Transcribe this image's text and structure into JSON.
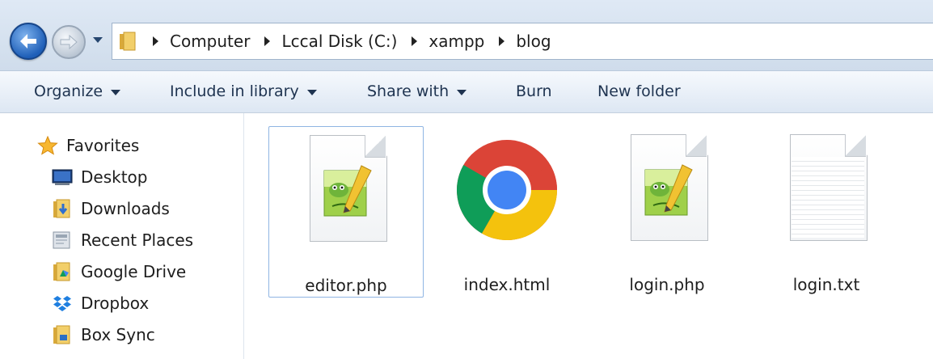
{
  "address": {
    "crumbs": [
      "Computer",
      "Lccal Disk (C:)",
      "xampp",
      "blog"
    ]
  },
  "toolbar": {
    "organize": "Organize",
    "include_in_library": "Include in library",
    "share_with": "Share with",
    "burn": "Burn",
    "new_folder": "New folder"
  },
  "sidebar": {
    "favorites": "Favorites",
    "items": [
      {
        "label": "Desktop",
        "icon": "desktop-icon"
      },
      {
        "label": "Downloads",
        "icon": "downloads-folder-icon"
      },
      {
        "label": "Recent Places",
        "icon": "recent-places-icon"
      },
      {
        "label": "Google Drive",
        "icon": "google-drive-icon"
      },
      {
        "label": "Dropbox",
        "icon": "dropbox-icon"
      },
      {
        "label": "Box Sync",
        "icon": "box-sync-folder-icon"
      }
    ]
  },
  "files": [
    {
      "name": "editor.php",
      "icon": "notepadpp-file-icon",
      "selected": true
    },
    {
      "name": "index.html",
      "icon": "chrome-icon",
      "selected": false
    },
    {
      "name": "login.php",
      "icon": "notepadpp-file-icon",
      "selected": false
    },
    {
      "name": "login.txt",
      "icon": "text-file-icon",
      "selected": false
    }
  ],
  "colors": {
    "selection_border": "#8fb5e3",
    "toolbar_text": "#1e3350",
    "chrome_red": "#db4437",
    "chrome_green": "#0f9d58",
    "chrome_yellow": "#f4c20d",
    "chrome_blue": "#4285f4"
  }
}
